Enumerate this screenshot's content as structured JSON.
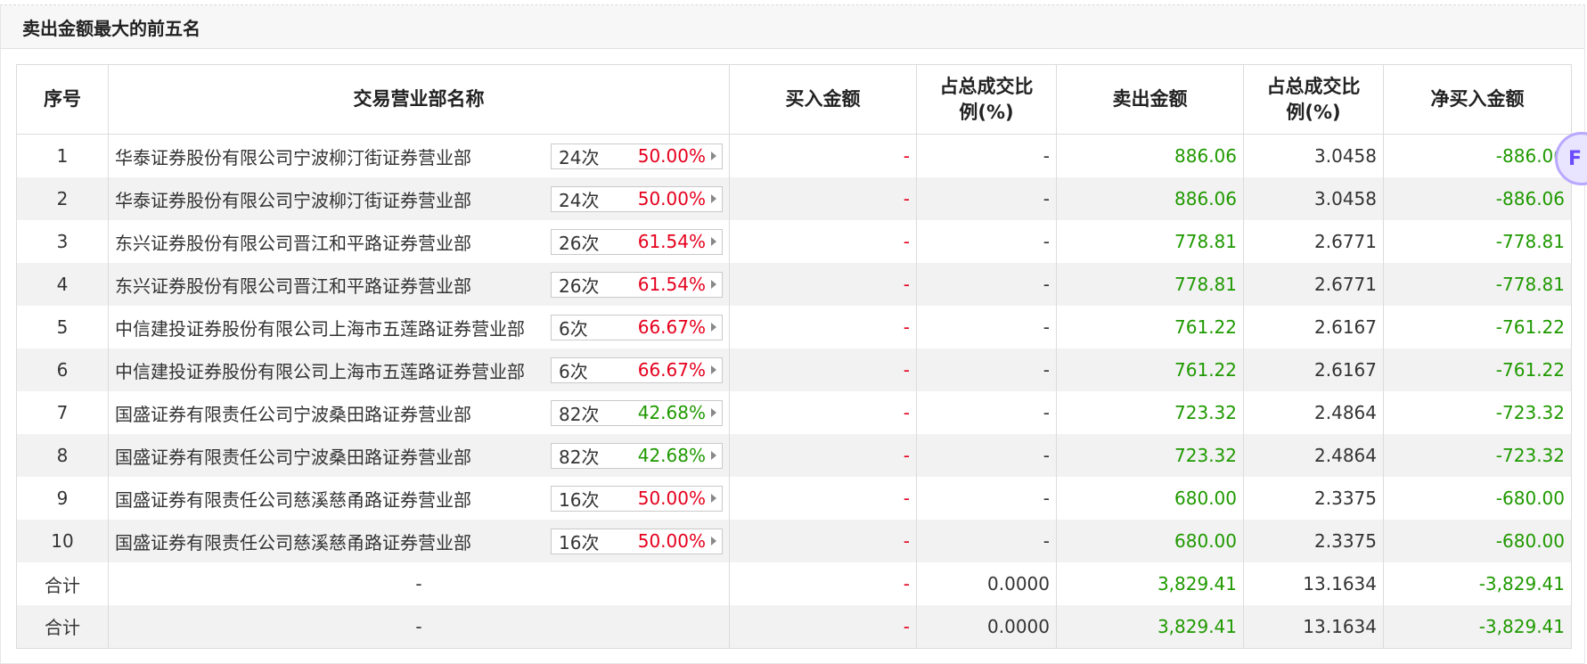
{
  "panel": {
    "title": "卖出金额最大的前五名"
  },
  "table": {
    "headers": {
      "index": "序号",
      "branch": "交易营业部名称",
      "buy": "买入金额",
      "buy_ratio_l1": "占总成交比",
      "buy_ratio_l2": "例(%)",
      "sell": "卖出金额",
      "sell_ratio_l1": "占总成交比",
      "sell_ratio_l2": "例(%)",
      "net": "净买入金额"
    },
    "rows": [
      {
        "idx": "1",
        "name": "华泰证券股份有限公司宁波柳汀街证券营业部",
        "count": "24次",
        "pct": "50.00%",
        "pct_color": "red",
        "buy": "-",
        "buy_ratio": "-",
        "sell": "886.06",
        "sell_ratio": "3.0458",
        "net": "-886.06"
      },
      {
        "idx": "2",
        "name": "华泰证券股份有限公司宁波柳汀街证券营业部",
        "count": "24次",
        "pct": "50.00%",
        "pct_color": "red",
        "buy": "-",
        "buy_ratio": "-",
        "sell": "886.06",
        "sell_ratio": "3.0458",
        "net": "-886.06"
      },
      {
        "idx": "3",
        "name": "东兴证券股份有限公司晋江和平路证券营业部",
        "count": "26次",
        "pct": "61.54%",
        "pct_color": "red",
        "buy": "-",
        "buy_ratio": "-",
        "sell": "778.81",
        "sell_ratio": "2.6771",
        "net": "-778.81"
      },
      {
        "idx": "4",
        "name": "东兴证券股份有限公司晋江和平路证券营业部",
        "count": "26次",
        "pct": "61.54%",
        "pct_color": "red",
        "buy": "-",
        "buy_ratio": "-",
        "sell": "778.81",
        "sell_ratio": "2.6771",
        "net": "-778.81"
      },
      {
        "idx": "5",
        "name": "中信建投证券股份有限公司上海市五莲路证券营业部",
        "count": "6次",
        "pct": "66.67%",
        "pct_color": "red",
        "buy": "-",
        "buy_ratio": "-",
        "sell": "761.22",
        "sell_ratio": "2.6167",
        "net": "-761.22"
      },
      {
        "idx": "6",
        "name": "中信建投证券股份有限公司上海市五莲路证券营业部",
        "count": "6次",
        "pct": "66.67%",
        "pct_color": "red",
        "buy": "-",
        "buy_ratio": "-",
        "sell": "761.22",
        "sell_ratio": "2.6167",
        "net": "-761.22"
      },
      {
        "idx": "7",
        "name": "国盛证券有限责任公司宁波桑田路证券营业部",
        "count": "82次",
        "pct": "42.68%",
        "pct_color": "green",
        "buy": "-",
        "buy_ratio": "-",
        "sell": "723.32",
        "sell_ratio": "2.4864",
        "net": "-723.32"
      },
      {
        "idx": "8",
        "name": "国盛证券有限责任公司宁波桑田路证券营业部",
        "count": "82次",
        "pct": "42.68%",
        "pct_color": "green",
        "buy": "-",
        "buy_ratio": "-",
        "sell": "723.32",
        "sell_ratio": "2.4864",
        "net": "-723.32"
      },
      {
        "idx": "9",
        "name": "国盛证券有限责任公司慈溪慈甬路证券营业部",
        "count": "16次",
        "pct": "50.00%",
        "pct_color": "red",
        "buy": "-",
        "buy_ratio": "-",
        "sell": "680.00",
        "sell_ratio": "2.3375",
        "net": "-680.00"
      },
      {
        "idx": "10",
        "name": "国盛证券有限责任公司慈溪慈甬路证券营业部",
        "count": "16次",
        "pct": "50.00%",
        "pct_color": "red",
        "buy": "-",
        "buy_ratio": "-",
        "sell": "680.00",
        "sell_ratio": "2.3375",
        "net": "-680.00"
      }
    ],
    "totals": [
      {
        "label": "合计",
        "name": "-",
        "buy": "-",
        "buy_ratio": "0.0000",
        "sell": "3,829.41",
        "sell_ratio": "13.1634",
        "net": "-3,829.41"
      },
      {
        "label": "合计",
        "name": "-",
        "buy": "-",
        "buy_ratio": "0.0000",
        "sell": "3,829.41",
        "sell_ratio": "13.1634",
        "net": "-3,829.41"
      }
    ]
  },
  "float_button": {
    "label": "F",
    "icon": "floating-feedback-icon"
  },
  "colors": {
    "red": "#e5001d",
    "green": "#1f9900",
    "header_bg": "#f7f7f7",
    "alt_row": "#f2f2f2"
  }
}
